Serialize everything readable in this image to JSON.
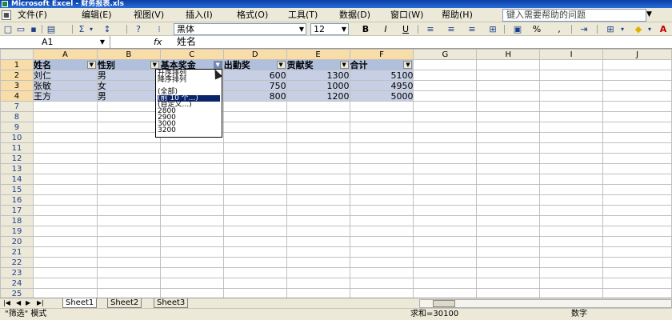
{
  "title": "Microsoft Excel - 财务报表.xls",
  "menu": {
    "items": [
      "文件(F)",
      "编辑(E)",
      "视图(V)",
      "插入(I)",
      "格式(O)",
      "工具(T)",
      "数据(D)",
      "窗口(W)",
      "帮助(H)"
    ],
    "help_placeholder": "键入需要帮助的问题"
  },
  "toolbar": {
    "font": "黑体",
    "size": "12",
    "bold": "B",
    "italic": "I",
    "underline": "U",
    "percent": "%",
    "sum": "Σ"
  },
  "formula_bar": {
    "cell_ref": "A1",
    "fx": "fx",
    "value": "姓名"
  },
  "columns": [
    "A",
    "B",
    "C",
    "D",
    "E",
    "F",
    "G",
    "H",
    "I",
    "J"
  ],
  "headers": [
    "姓名",
    "性别",
    "基本奖金",
    "出勤奖",
    "贡献奖",
    "合计"
  ],
  "rows": [
    [
      "刘仁",
      "男",
      "",
      "600",
      "1300",
      "5100"
    ],
    [
      "张敏",
      "女",
      "",
      "750",
      "1000",
      "4950"
    ],
    [
      "王方",
      "男",
      "",
      "800",
      "1200",
      "5000"
    ]
  ],
  "row_numbers": [
    "1",
    "2",
    "3",
    "4",
    "7",
    "8",
    "9",
    "10",
    "11",
    "12",
    "13",
    "14",
    "15",
    "16",
    "17",
    "18",
    "19",
    "20",
    "21",
    "22",
    "23",
    "24",
    "25"
  ],
  "dropdown": {
    "items": [
      "升序排列",
      "降序排列",
      "",
      "(全部)",
      "(前 10 个...)",
      "(自定义...)",
      "2800",
      "2900",
      "3000",
      "3200"
    ],
    "highlighted": "(前 10 个...)"
  },
  "sheets": [
    "Sheet1",
    "Sheet2",
    "Sheet3"
  ],
  "active_sheet": "Sheet1",
  "status": {
    "mode": "\"筛选\" 模式",
    "sum": "求和=30100",
    "num": "数字"
  }
}
